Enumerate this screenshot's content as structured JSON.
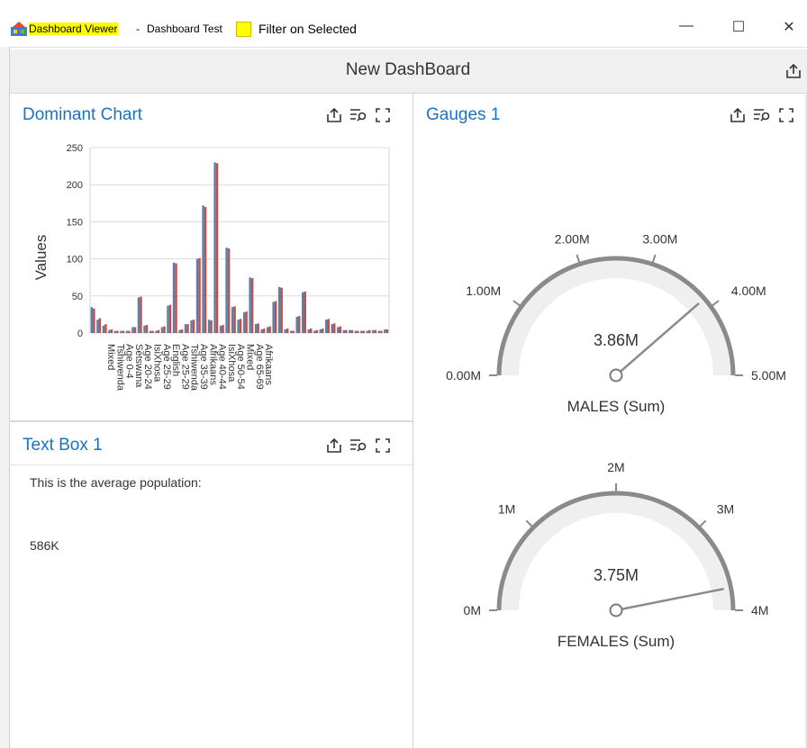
{
  "window": {
    "title_app": "Dashboard Viewer",
    "title_sep": " - ",
    "title_doc": "Dashboard Test",
    "filter_label": "Filter on Selected",
    "filter_checked": false,
    "minimize_glyph": "—",
    "maximize_glyph": "☐",
    "close_glyph": "✕"
  },
  "dashboard": {
    "title": "New DashBoard"
  },
  "panels": {
    "chart": {
      "title": "Dominant Chart"
    },
    "gauges": {
      "title": "Gauges 1"
    },
    "textbox": {
      "title": "Text Box 1",
      "line1": "This is the average population:",
      "value": "586K"
    }
  },
  "icons": [
    "app-icon",
    "export-icon",
    "filter-icon",
    "maximize-icon"
  ],
  "chart_data": {
    "type": "bar",
    "ylabel": "Values",
    "ylim": [
      0,
      250
    ],
    "yticks": [
      "0",
      "50",
      "100",
      "150",
      "200",
      "250"
    ],
    "xtick_labels": [
      "Mixed",
      "Tshiwenda",
      "Age 0-4",
      "Setswana",
      "Age 20-24",
      "IsiXhosa",
      "Age 25-29",
      "English",
      "Age 25-29",
      "Tshiwenda",
      "Age 35-39",
      "Afrikaans",
      "Age 40-44",
      "IsiXhosa",
      "Age 50-54",
      "Mixed",
      "Age 65-69",
      "Afrikaans"
    ],
    "series": [
      {
        "values": [
          35,
          18,
          10,
          4,
          3,
          3,
          3,
          8,
          48,
          10,
          3,
          3,
          8,
          37,
          95,
          4,
          12,
          17,
          100,
          172,
          18,
          230,
          10,
          115,
          35,
          18,
          28,
          75,
          12,
          5,
          8,
          42,
          62,
          5,
          3,
          22,
          55,
          5,
          3,
          5,
          18,
          12,
          8,
          4,
          4,
          3,
          3,
          3,
          4,
          3,
          5
        ]
      },
      {
        "values": [
          33,
          20,
          12,
          5,
          3,
          3,
          3,
          8,
          49,
          11,
          3,
          4,
          9,
          38,
          94,
          5,
          12,
          18,
          101,
          170,
          17,
          229,
          11,
          114,
          36,
          19,
          29,
          74,
          13,
          6,
          9,
          43,
          61,
          6,
          3,
          23,
          56,
          6,
          4,
          6,
          19,
          13,
          9,
          4,
          4,
          3,
          3,
          4,
          4,
          3,
          5
        ]
      }
    ],
    "colors": {
      "s1": "#5b7fa8",
      "s2": "#c0504d"
    }
  },
  "gauges": [
    {
      "label": "MALES (Sum)",
      "value_text": "3.86M",
      "value": 3.86,
      "min": 0,
      "max": 5,
      "tick_labels": [
        "0.00M",
        "1.00M",
        "2.00M",
        "3.00M",
        "4.00M",
        "5.00M"
      ]
    },
    {
      "label": "FEMALES (Sum)",
      "value_text": "3.75M",
      "value": 3.75,
      "min": 0,
      "max": 4,
      "tick_labels": [
        "0M",
        "1M",
        "2M",
        "3M",
        "4M"
      ]
    }
  ]
}
